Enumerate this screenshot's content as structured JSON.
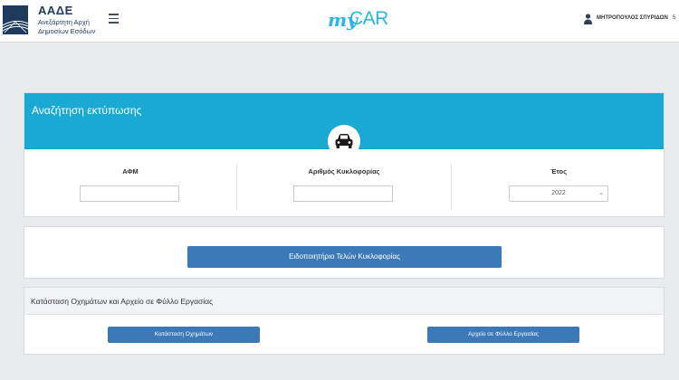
{
  "header": {
    "org_short": "ΑΑΔΕ",
    "org_line1": "Ανεξάρτητη Αρχή",
    "org_line2": "Δημοσίων Εσόδων",
    "brand_my": "my",
    "brand_car": "CAR",
    "user_name": "ΜΗΤΡΟΠΟΥΛΟΣ ΣΠΥΡΙΔΩΝ",
    "user_extra": "5 ",
    "icons": {
      "menu": "hamburger-menu-icon",
      "user": "user-icon",
      "logo": "aade-logo-icon"
    }
  },
  "search": {
    "title": "Αναζήτηση εκτύπωσης",
    "badge_icon": "car-icon",
    "fields": [
      {
        "label": "ΑΦΜ",
        "value": "",
        "placeholder": ""
      },
      {
        "label": "Αριθμός Κυκλοφορίας",
        "value": "",
        "placeholder": ""
      },
      {
        "label": "Έτος",
        "selected": "2022"
      }
    ]
  },
  "notice": {
    "button_label": "Ειδοποιητήριο Τελών Κυκλοφορίας"
  },
  "status": {
    "title": "Κατάσταση Οχημάτων και Αρχείο σε Φύλλο Εργασίας",
    "vehicle_status_label": "Κατάσταση Οχημάτων",
    "worksheet_file_label": "Αρχείο σε Φύλλο Εργασίας"
  },
  "colors": {
    "accent": "#1aa9d2",
    "button": "#3c79b8",
    "background": "#e9ebee",
    "brand": "#29b6e0"
  }
}
